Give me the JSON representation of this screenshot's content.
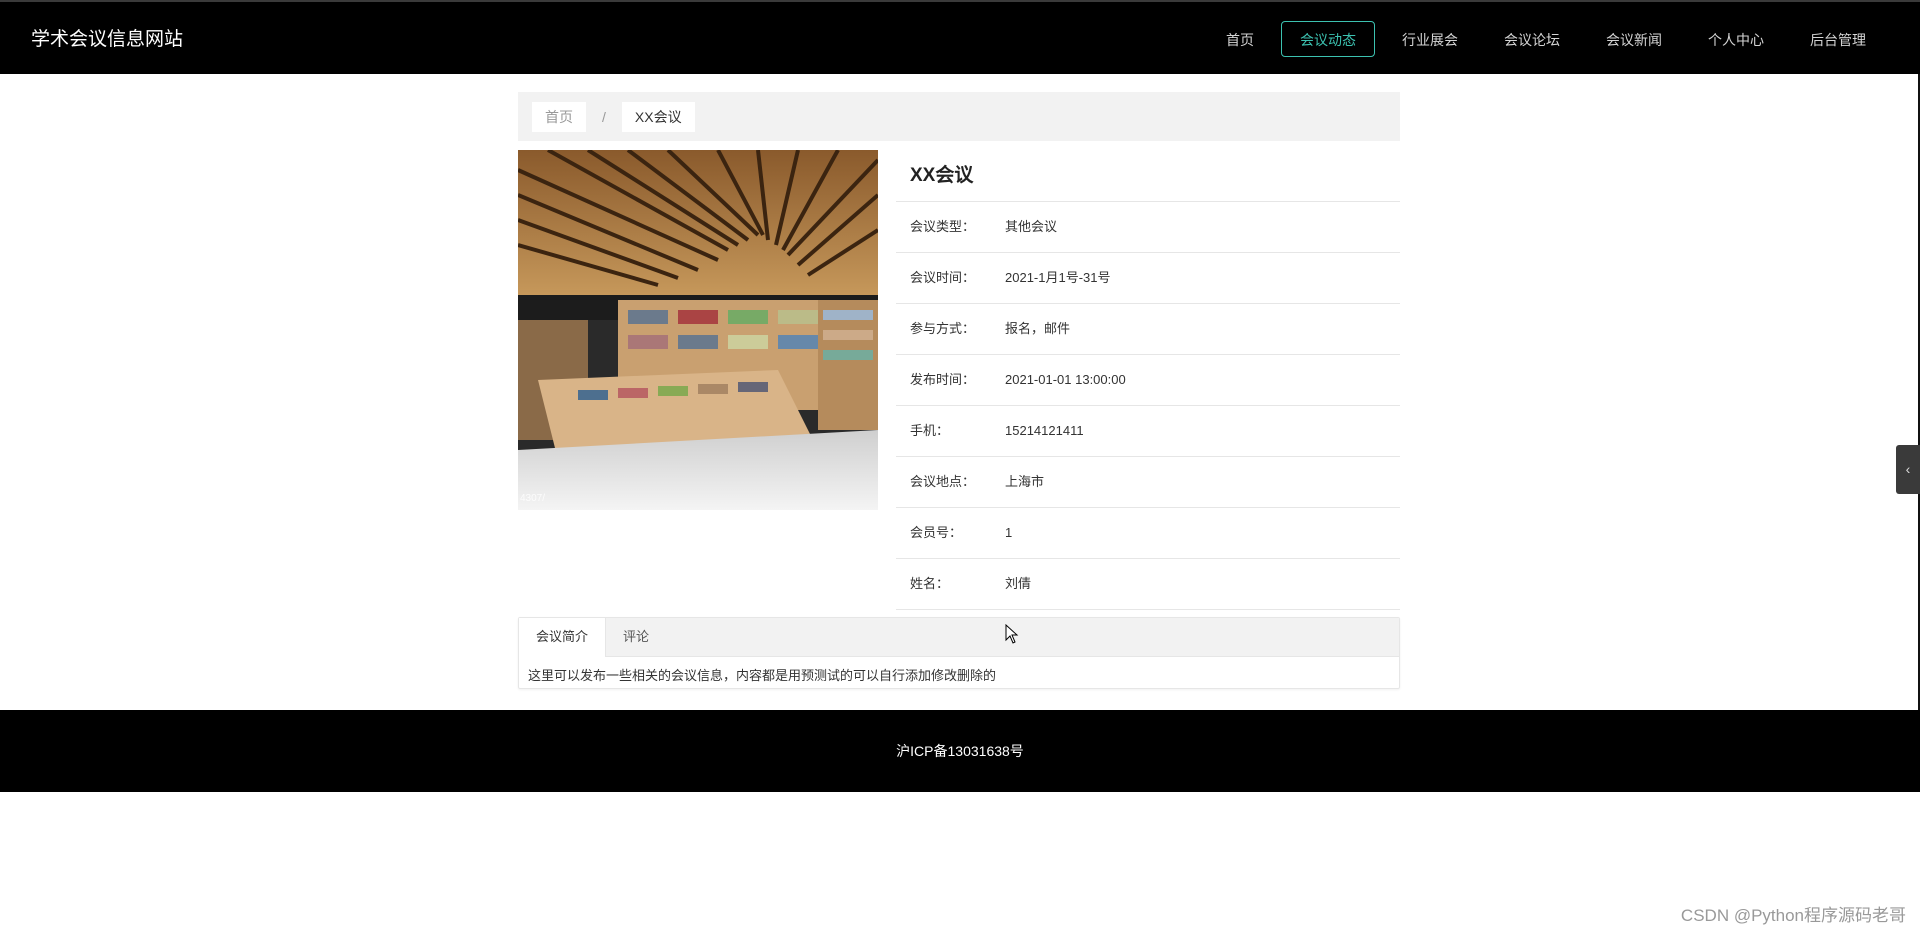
{
  "site": {
    "title": "学术会议信息网站"
  },
  "nav": {
    "items": [
      {
        "label": "首页"
      },
      {
        "label": "会议动态"
      },
      {
        "label": "行业展会"
      },
      {
        "label": "会议论坛"
      },
      {
        "label": "会议新闻"
      },
      {
        "label": "个人中心"
      },
      {
        "label": "后台管理"
      }
    ],
    "active_index": 1
  },
  "breadcrumb": {
    "home": "首页",
    "separator": "/",
    "current": "XX会议"
  },
  "photo": {
    "caption": "4307/"
  },
  "detail": {
    "title": "XX会议",
    "rows": [
      {
        "label": "会议类型：",
        "value": "其他会议"
      },
      {
        "label": "会议时间：",
        "value": "2021-1月1号-31号"
      },
      {
        "label": "参与方式：",
        "value": "报名，邮件"
      },
      {
        "label": "发布时间：",
        "value": "2021-01-01 13:00:00"
      },
      {
        "label": "手机：",
        "value": "15214121411"
      },
      {
        "label": "会议地点：",
        "value": "上海市"
      },
      {
        "label": "会员号：",
        "value": "1"
      },
      {
        "label": "姓名：",
        "value": "刘倩"
      }
    ]
  },
  "tabs": {
    "items": [
      {
        "label": "会议简介"
      },
      {
        "label": "评论"
      }
    ],
    "content": "这里可以发布一些相关的会议信息，内容都是用预测试的可以自行添加修改删除的"
  },
  "footer": {
    "icp": "沪ICP备13031638号"
  },
  "side_tab": {
    "icon": "chevron-left-icon",
    "glyph": "‹"
  },
  "watermark": "CSDN @Python程序源码老哥",
  "colors": {
    "accent": "#3cc1b0",
    "header_bg": "#000000"
  }
}
